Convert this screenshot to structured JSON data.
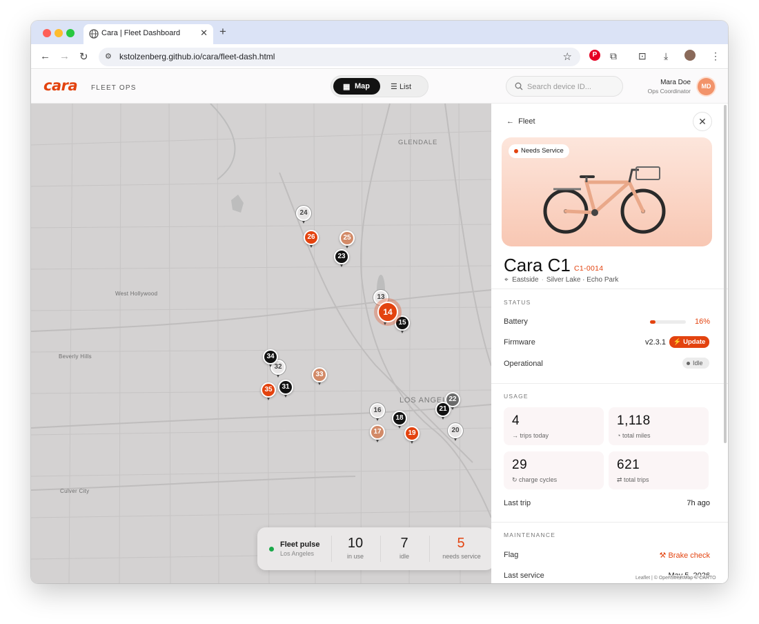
{
  "browser": {
    "tab_title": "Cara | Fleet Dashboard",
    "url": "kstolzenberg.github.io/cara/fleet-dash.html",
    "icons": [
      "back-icon",
      "forward-icon",
      "reload-icon",
      "star-icon",
      "pinterest-icon",
      "extensions-icon",
      "tab-search-icon",
      "download-icon",
      "profile-icon",
      "menu-icon"
    ]
  },
  "header": {
    "logo": "cara",
    "subtitle": "FLEET OPS",
    "view_toggle": {
      "map": "Map",
      "list": "List",
      "active": "Map"
    },
    "search_placeholder": "Search device ID...",
    "user_name": "Mara Doe",
    "user_role": "Ops Coordinator",
    "user_initials": "MD"
  },
  "map": {
    "labels": {
      "glendale": "GLENDALE",
      "west_hollywood": "West Hollywood",
      "beverly_hills": "Beverly Hills",
      "los_angeles": "LOS ANGELES",
      "culver_city": "Culver City"
    },
    "pins": [
      {
        "id": "24",
        "status": "light"
      },
      {
        "id": "26",
        "status": "needs-service"
      },
      {
        "id": "25",
        "status": "low"
      },
      {
        "id": "23",
        "status": "in-use"
      },
      {
        "id": "13",
        "status": "light"
      },
      {
        "id": "14",
        "status": "needs-service-selected"
      },
      {
        "id": "15",
        "status": "in-use"
      },
      {
        "id": "34",
        "status": "in-use"
      },
      {
        "id": "32",
        "status": "light"
      },
      {
        "id": "33",
        "status": "low"
      },
      {
        "id": "35",
        "status": "needs-service"
      },
      {
        "id": "31",
        "status": "in-use"
      },
      {
        "id": "22",
        "status": "grey"
      },
      {
        "id": "21",
        "status": "in-use"
      },
      {
        "id": "16",
        "status": "light"
      },
      {
        "id": "18",
        "status": "in-use"
      },
      {
        "id": "17",
        "status": "low"
      },
      {
        "id": "19",
        "status": "needs-service"
      },
      {
        "id": "20",
        "status": "light"
      }
    ],
    "attribution": "Leaflet | © OpenStreetMap © CARTO"
  },
  "pulse": {
    "title": "Fleet pulse",
    "subtitle": "Los Angeles",
    "in_use": "10",
    "in_use_label": "in use",
    "idle": "7",
    "idle_label": "idle",
    "needs_service": "5",
    "needs_service_label": "needs service"
  },
  "detail": {
    "back_label": "Fleet",
    "badge": "Needs Service",
    "model": "Cara C1",
    "serial": "C1-0014",
    "neighborhood": "Eastside",
    "area": "Silver Lake · Echo Park",
    "status": {
      "title": "STATUS",
      "battery_label": "Battery",
      "battery_value": "16%",
      "battery_fraction": 0.16,
      "firmware_label": "Firmware",
      "firmware_value": "v2.3.1",
      "update_label": "Update",
      "operational_label": "Operational",
      "operational_value": "Idle"
    },
    "usage": {
      "title": "USAGE",
      "trips_today": "4",
      "trips_today_label": "trips today",
      "total_miles": "1,118",
      "total_miles_label": "total miles",
      "charge_cycles": "29",
      "charge_cycles_label": "charge cycles",
      "total_trips": "621",
      "total_trips_label": "total trips",
      "last_trip_label": "Last trip",
      "last_trip_value": "7h ago"
    },
    "maintenance": {
      "title": "MAINTENANCE",
      "flag_label": "Flag",
      "flag_value": "Brake check",
      "last_service_label": "Last service",
      "last_service_value": "May 5, 2026"
    }
  },
  "colors": {
    "accent": "#e3430f",
    "dark": "#121212",
    "ok": "#1aa94a"
  }
}
